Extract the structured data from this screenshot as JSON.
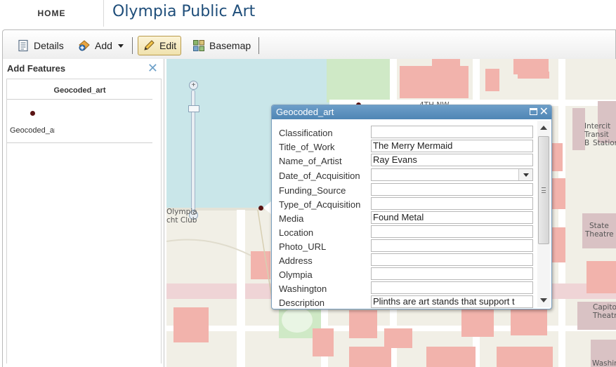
{
  "header": {
    "home_label": "HOME",
    "app_title": "Olympia Public Art"
  },
  "toolbar": {
    "details_label": "Details",
    "add_label": "Add",
    "edit_label": "Edit",
    "basemap_label": "Basemap"
  },
  "left_panel": {
    "title": "Add Features",
    "layer_name": "Geocoded_art",
    "template_label": "Geocoded_art"
  },
  "map": {
    "labels": {
      "street_top": "4TH NW",
      "yacht_club_1": "Olympia",
      "yacht_club_2": "cht Club",
      "intercity_1": "Intercit",
      "intercity_2": "Transit B",
      "intercity_3": "Station",
      "state_theatre_1": "State",
      "state_theatre_2": "Theatre",
      "capitol_theatre_1": "Capito",
      "capitol_theatre_2": "Theatr",
      "washington": "Washin"
    }
  },
  "popup": {
    "title": "Geocoded_art",
    "fields": [
      {
        "label": "Classification",
        "value": ""
      },
      {
        "label": "Title_of_Work",
        "value": "The Merry Mermaid"
      },
      {
        "label": "Name_of_Artist",
        "value": "Ray Evans"
      },
      {
        "label": "Date_of_Acquisition",
        "value": ""
      },
      {
        "label": "Funding_Source",
        "value": ""
      },
      {
        "label": "Type_of_Acquisition",
        "value": ""
      },
      {
        "label": "Media",
        "value": "Found Metal"
      },
      {
        "label": "Location",
        "value": ""
      },
      {
        "label": "Photo_URL",
        "value": ""
      },
      {
        "label": "Address",
        "value": ""
      },
      {
        "label": "Olympia",
        "value": ""
      },
      {
        "label": "Washington",
        "value": ""
      },
      {
        "label": "Description",
        "value": "Plinths are art stands that support t"
      }
    ]
  },
  "colors": {
    "title_blue": "#1f4e7a",
    "popup_header": "#5b8fbc",
    "building": "#f2b3ac",
    "park": "#cfe9c6",
    "water": "#c9e6e9",
    "point": "#5a1414"
  }
}
